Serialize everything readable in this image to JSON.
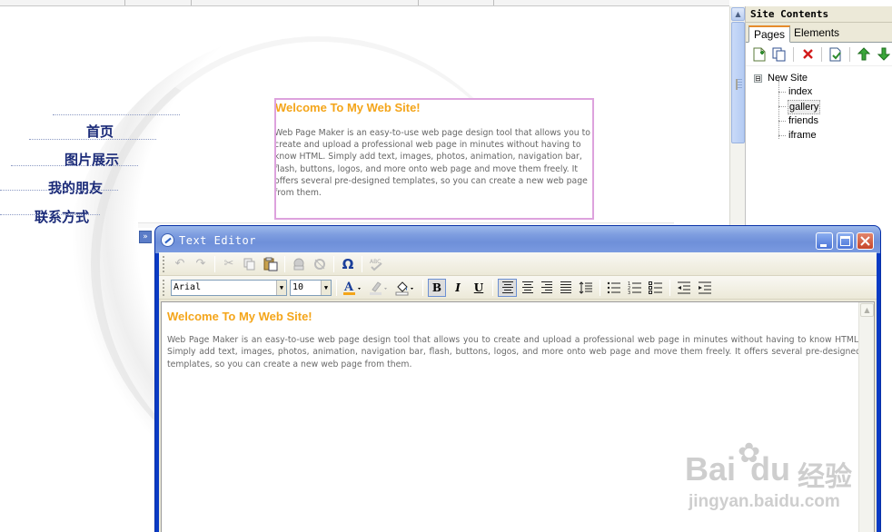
{
  "canvas": {
    "nav_links": [
      {
        "label": "首页"
      },
      {
        "label": "图片展示"
      },
      {
        "label": "我的朋友"
      },
      {
        "label": "联系方式"
      }
    ],
    "content_box": {
      "heading": "Welcome To My Web Site!",
      "body": "Web Page Maker is an easy-to-use web page design tool that allows you to create and upload a professional web page in minutes without having to know HTML. Simply add text, images, photos, animation, navigation bar, flash, buttons, logos, and more onto web page and move them freely. It offers several pre-designed templates, so you can create a new web page from them."
    },
    "expand_button": "»"
  },
  "site_panel": {
    "title": "Site Contents",
    "tabs": [
      {
        "label": "Pages",
        "active": true
      },
      {
        "label": "Elements",
        "active": false
      }
    ],
    "toolbar": {
      "new_page_icon": "new-page-icon",
      "duplicate_icon": "duplicate-icon",
      "delete_icon": "delete-icon",
      "preview_icon": "preview-icon",
      "move_up_icon": "arrow-up-icon",
      "move_down_icon": "arrow-down-icon"
    },
    "tree": {
      "root_toggle": "⊟",
      "root": "New Site",
      "pages": [
        {
          "label": "index",
          "selected": false
        },
        {
          "label": "gallery",
          "selected": true
        },
        {
          "label": "friends",
          "selected": false
        },
        {
          "label": "iframe",
          "selected": false
        }
      ]
    }
  },
  "editor": {
    "title": "Text Editor",
    "font_family": "Arial",
    "font_size": "10",
    "content": {
      "heading": "Welcome To My Web Site!",
      "body": "Web Page Maker is an easy-to-use web page design tool that allows you to create and upload a professional web page in minutes without having to know HTML. Simply add text, images, photos, animation, navigation bar, flash, buttons, logos, and more onto web page and move them freely. It offers several pre-designed templates, so you can create a new web page from them."
    },
    "format_buttons": {
      "bold": "B",
      "italic": "I",
      "underline": "U"
    },
    "special_char": "Ω"
  },
  "watermark": {
    "line1": "Bai",
    "line1b": "du",
    "line1c": "经验",
    "line2": "jingyan.baidu.com"
  },
  "colors": {
    "heading": "#f4a51a",
    "nav_text": "#1a2a78",
    "xp_title": "#6e8fd9",
    "selection_border": "#dda2dd"
  }
}
